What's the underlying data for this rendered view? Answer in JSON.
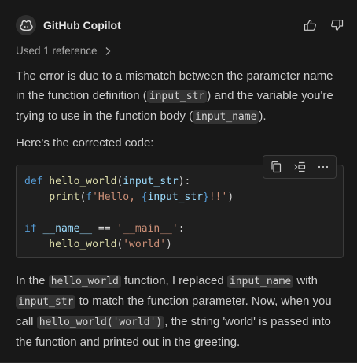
{
  "header": {
    "title": "GitHub Copilot",
    "icons": [
      "copilot-icon",
      "thumbs-up-icon",
      "thumbs-down-icon"
    ]
  },
  "reference": {
    "label": "Used 1 reference"
  },
  "para1": {
    "t1": "The error is due to a mismatch between the parameter name in the function definition (",
    "c1": "input_str",
    "t2": ") and the variable you're trying to use in the function body (",
    "c2": "input_name",
    "t3": ")."
  },
  "para2": {
    "text": "Here's the corrected code:"
  },
  "code": {
    "toolbar_icons": [
      "copy-icon",
      "insert-at-cursor-icon",
      "more-actions-icon"
    ],
    "line1": {
      "kw": "def",
      "sp": " ",
      "fn": "hello_world",
      "open": "(",
      "param": "input_str",
      "close": "):"
    },
    "line2": {
      "indent": "    ",
      "fn": "print",
      "open": "(",
      "prefix": "f",
      "str1": "'Hello, ",
      "br_open": "{",
      "var": "input_str",
      "br_close": "}",
      "str2": "!!'",
      "close": ")"
    },
    "line4": {
      "kw": "if",
      "sp": " ",
      "dunder": "__name__",
      "op": " == ",
      "str": "'__main__'",
      "colon": ":"
    },
    "line5": {
      "indent": "    ",
      "fn": "hello_world",
      "open": "(",
      "str": "'world'",
      "close": ")"
    }
  },
  "para3": {
    "t1": "In the ",
    "c1": "hello_world",
    "t2": " function, I replaced ",
    "c2": "input_name",
    "t3": " with ",
    "c3": "input_str",
    "t4": " to match the function parameter. Now, when you call ",
    "c4": "hello_world('world')",
    "t5": ", the string 'world' is passed into the function and printed out in the greeting."
  },
  "colors": {
    "background": "#181818",
    "keyword": "#569cd6",
    "function": "#dcdcaa",
    "parameter": "#9cdcfe",
    "string": "#ce9178"
  }
}
